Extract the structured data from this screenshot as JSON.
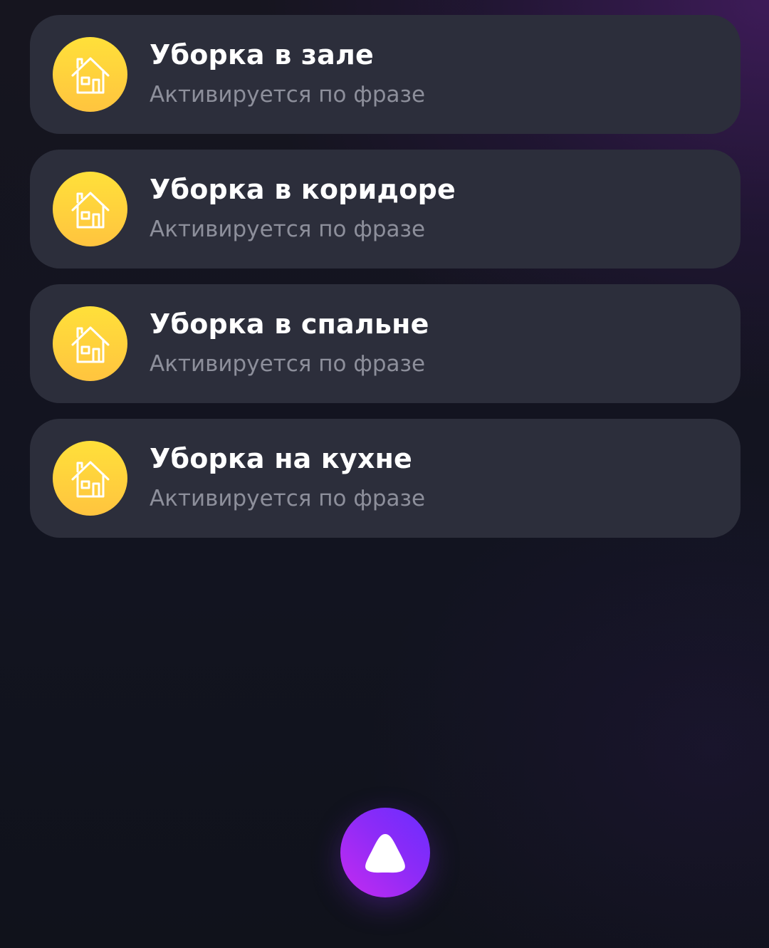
{
  "scenarios": [
    {
      "title": "Уборка в зале",
      "subtitle": "Активируется по фразе",
      "icon": "house-icon"
    },
    {
      "title": "Уборка в коридоре",
      "subtitle": "Активируется по фразе",
      "icon": "house-icon"
    },
    {
      "title": "Уборка в спальне",
      "subtitle": "Активируется по фразе",
      "icon": "house-icon"
    },
    {
      "title": "Уборка на кухне",
      "subtitle": "Активируется по фразе",
      "icon": "house-icon"
    }
  ],
  "assistant_button": {
    "icon": "alice-icon"
  },
  "colors": {
    "card_background": "#2c2e3b",
    "icon_yellow": "#ffd83d",
    "subtitle_gray": "#8d8f9b",
    "assistant_purple": "#8d2bf7"
  }
}
